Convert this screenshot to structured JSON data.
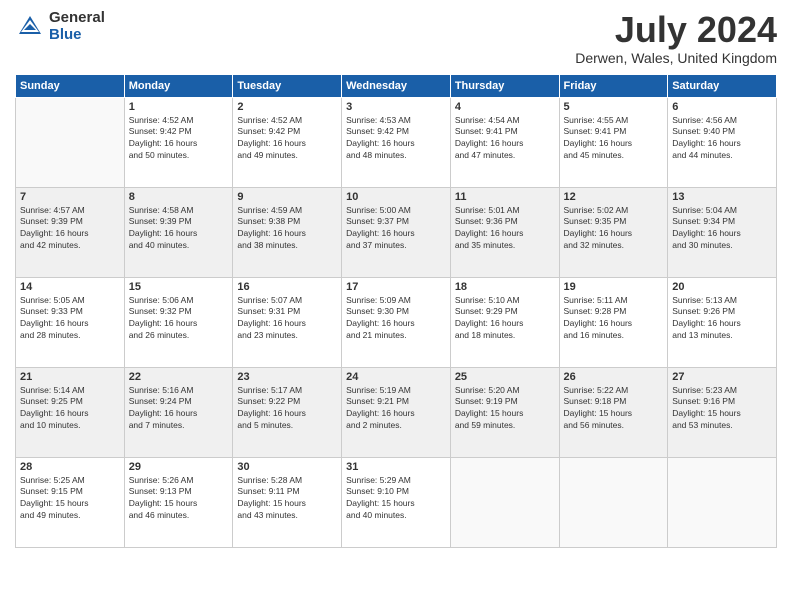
{
  "logo": {
    "general": "General",
    "blue": "Blue"
  },
  "title": "July 2024",
  "location": "Derwen, Wales, United Kingdom",
  "headers": [
    "Sunday",
    "Monday",
    "Tuesday",
    "Wednesday",
    "Thursday",
    "Friday",
    "Saturday"
  ],
  "weeks": [
    [
      {
        "day": "",
        "info": ""
      },
      {
        "day": "1",
        "info": "Sunrise: 4:52 AM\nSunset: 9:42 PM\nDaylight: 16 hours\nand 50 minutes."
      },
      {
        "day": "2",
        "info": "Sunrise: 4:52 AM\nSunset: 9:42 PM\nDaylight: 16 hours\nand 49 minutes."
      },
      {
        "day": "3",
        "info": "Sunrise: 4:53 AM\nSunset: 9:42 PM\nDaylight: 16 hours\nand 48 minutes."
      },
      {
        "day": "4",
        "info": "Sunrise: 4:54 AM\nSunset: 9:41 PM\nDaylight: 16 hours\nand 47 minutes."
      },
      {
        "day": "5",
        "info": "Sunrise: 4:55 AM\nSunset: 9:41 PM\nDaylight: 16 hours\nand 45 minutes."
      },
      {
        "day": "6",
        "info": "Sunrise: 4:56 AM\nSunset: 9:40 PM\nDaylight: 16 hours\nand 44 minutes."
      }
    ],
    [
      {
        "day": "7",
        "info": "Sunrise: 4:57 AM\nSunset: 9:39 PM\nDaylight: 16 hours\nand 42 minutes."
      },
      {
        "day": "8",
        "info": "Sunrise: 4:58 AM\nSunset: 9:39 PM\nDaylight: 16 hours\nand 40 minutes."
      },
      {
        "day": "9",
        "info": "Sunrise: 4:59 AM\nSunset: 9:38 PM\nDaylight: 16 hours\nand 38 minutes."
      },
      {
        "day": "10",
        "info": "Sunrise: 5:00 AM\nSunset: 9:37 PM\nDaylight: 16 hours\nand 37 minutes."
      },
      {
        "day": "11",
        "info": "Sunrise: 5:01 AM\nSunset: 9:36 PM\nDaylight: 16 hours\nand 35 minutes."
      },
      {
        "day": "12",
        "info": "Sunrise: 5:02 AM\nSunset: 9:35 PM\nDaylight: 16 hours\nand 32 minutes."
      },
      {
        "day": "13",
        "info": "Sunrise: 5:04 AM\nSunset: 9:34 PM\nDaylight: 16 hours\nand 30 minutes."
      }
    ],
    [
      {
        "day": "14",
        "info": "Sunrise: 5:05 AM\nSunset: 9:33 PM\nDaylight: 16 hours\nand 28 minutes."
      },
      {
        "day": "15",
        "info": "Sunrise: 5:06 AM\nSunset: 9:32 PM\nDaylight: 16 hours\nand 26 minutes."
      },
      {
        "day": "16",
        "info": "Sunrise: 5:07 AM\nSunset: 9:31 PM\nDaylight: 16 hours\nand 23 minutes."
      },
      {
        "day": "17",
        "info": "Sunrise: 5:09 AM\nSunset: 9:30 PM\nDaylight: 16 hours\nand 21 minutes."
      },
      {
        "day": "18",
        "info": "Sunrise: 5:10 AM\nSunset: 9:29 PM\nDaylight: 16 hours\nand 18 minutes."
      },
      {
        "day": "19",
        "info": "Sunrise: 5:11 AM\nSunset: 9:28 PM\nDaylight: 16 hours\nand 16 minutes."
      },
      {
        "day": "20",
        "info": "Sunrise: 5:13 AM\nSunset: 9:26 PM\nDaylight: 16 hours\nand 13 minutes."
      }
    ],
    [
      {
        "day": "21",
        "info": "Sunrise: 5:14 AM\nSunset: 9:25 PM\nDaylight: 16 hours\nand 10 minutes."
      },
      {
        "day": "22",
        "info": "Sunrise: 5:16 AM\nSunset: 9:24 PM\nDaylight: 16 hours\nand 7 minutes."
      },
      {
        "day": "23",
        "info": "Sunrise: 5:17 AM\nSunset: 9:22 PM\nDaylight: 16 hours\nand 5 minutes."
      },
      {
        "day": "24",
        "info": "Sunrise: 5:19 AM\nSunset: 9:21 PM\nDaylight: 16 hours\nand 2 minutes."
      },
      {
        "day": "25",
        "info": "Sunrise: 5:20 AM\nSunset: 9:19 PM\nDaylight: 15 hours\nand 59 minutes."
      },
      {
        "day": "26",
        "info": "Sunrise: 5:22 AM\nSunset: 9:18 PM\nDaylight: 15 hours\nand 56 minutes."
      },
      {
        "day": "27",
        "info": "Sunrise: 5:23 AM\nSunset: 9:16 PM\nDaylight: 15 hours\nand 53 minutes."
      }
    ],
    [
      {
        "day": "28",
        "info": "Sunrise: 5:25 AM\nSunset: 9:15 PM\nDaylight: 15 hours\nand 49 minutes."
      },
      {
        "day": "29",
        "info": "Sunrise: 5:26 AM\nSunset: 9:13 PM\nDaylight: 15 hours\nand 46 minutes."
      },
      {
        "day": "30",
        "info": "Sunrise: 5:28 AM\nSunset: 9:11 PM\nDaylight: 15 hours\nand 43 minutes."
      },
      {
        "day": "31",
        "info": "Sunrise: 5:29 AM\nSunset: 9:10 PM\nDaylight: 15 hours\nand 40 minutes."
      },
      {
        "day": "",
        "info": ""
      },
      {
        "day": "",
        "info": ""
      },
      {
        "day": "",
        "info": ""
      }
    ]
  ]
}
